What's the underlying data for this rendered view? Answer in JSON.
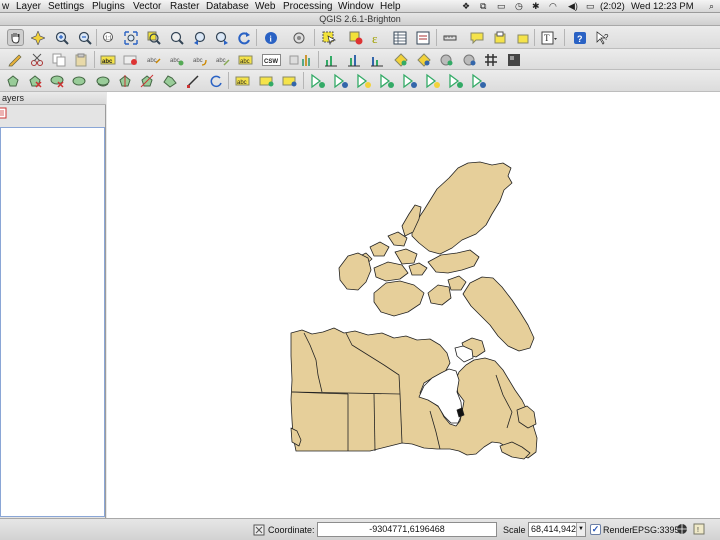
{
  "menubar": {
    "items": [
      "w",
      "Layer",
      "Settings",
      "Plugins",
      "Vector",
      "Raster",
      "Database",
      "Web",
      "Processing",
      "Window",
      "Help"
    ],
    "battery": "(2:02)",
    "clock": "Wed 12:23 PM"
  },
  "window": {
    "title": "QGIS 2.6.1-Brighton"
  },
  "toolbar1": {
    "icons": [
      "pan-hand-icon",
      "pan-to-selection-icon",
      "zoom-in-icon",
      "zoom-out-icon",
      "zoom-native-resolution-icon",
      "zoom-full-icon",
      "zoom-to-selection-icon",
      "zoom-to-layer-icon",
      "zoom-last-icon",
      "zoom-next-icon",
      "refresh-icon",
      "identify-icon",
      "measure-icon",
      "select-features-icon",
      "deselect-icon",
      "expression-select-icon",
      "attribute-table-icon",
      "field-calculator-icon",
      "measure-line-icon",
      "annotation-icon",
      "new-bookmark-icon",
      "show-bookmarks-icon",
      "text-annotation-icon",
      "help-icon",
      "whats-this-icon"
    ]
  },
  "toolbar2": {
    "icons": [
      "label-icon",
      "pin-labels-icon",
      "show-hide-labels-icon",
      "move-label-icon",
      "rotate-label-icon",
      "change-label-icon",
      "csw-icon"
    ],
    "csw_text": "CSW"
  },
  "toolbar3": {
    "icons": [
      "digitize-icon"
    ]
  },
  "layers_panel": {
    "title": "ayers"
  },
  "statusbar": {
    "coordinate_label": "Coordinate:",
    "coordinate_value": "-9304771,6196468",
    "scale_label": "Scale",
    "scale_value": "68,414,942",
    "render_label": "Render",
    "crs": "EPSG:3395"
  },
  "map": {
    "fill_color": "#e6cf9a",
    "outline_color": "#222222",
    "layer": "Canada provinces"
  }
}
